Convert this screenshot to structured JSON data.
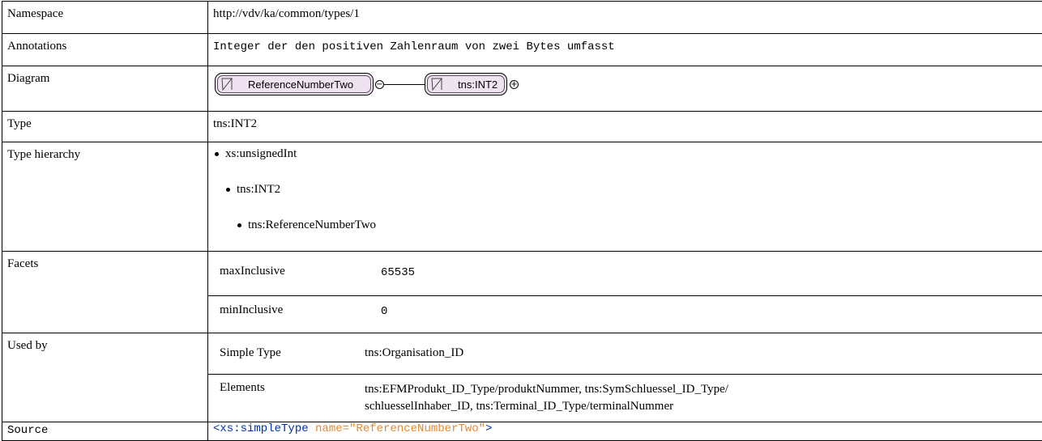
{
  "rows": {
    "namespace": {
      "label": "Namespace",
      "value": "http://vdv/ka/common/types/1"
    },
    "annotations": {
      "label": "Annotations",
      "value": "Integer der den positiven Zahlenraum von zwei Bytes umfasst"
    },
    "diagram": {
      "label": "Diagram",
      "node1": "ReferenceNumberTwo",
      "node2": "tns:INT2",
      "toggle_minus": "−",
      "toggle_plus": "+"
    },
    "type": {
      "label": "Type",
      "value": "tns:INT2"
    },
    "hierarchy": {
      "label": "Type hierarchy",
      "items": [
        "xs:unsignedInt",
        "tns:INT2",
        "tns:ReferenceNumberTwo"
      ]
    },
    "facets": {
      "label": "Facets",
      "items": [
        {
          "name": "maxInclusive",
          "value": "65535"
        },
        {
          "name": "minInclusive",
          "value": "0"
        }
      ]
    },
    "used_by": {
      "label": "Used by",
      "items": [
        {
          "kind": "Simple Type",
          "refs": "tns:Organisation_ID"
        },
        {
          "kind": "Elements",
          "refs_line1": "tns:EFMProdukt_ID_Type/produktNummer, tns:SymSchluessel_ID_Type/",
          "refs_line2": "schluesselInhaber_ID, tns:Terminal_ID_Type/terminalNummer"
        }
      ]
    },
    "source": {
      "label": "Source",
      "tag": "<xs:simpleType",
      "attr": "name=",
      "attr_value": "\"ReferenceNumberTwo\"",
      "close": ">"
    }
  }
}
